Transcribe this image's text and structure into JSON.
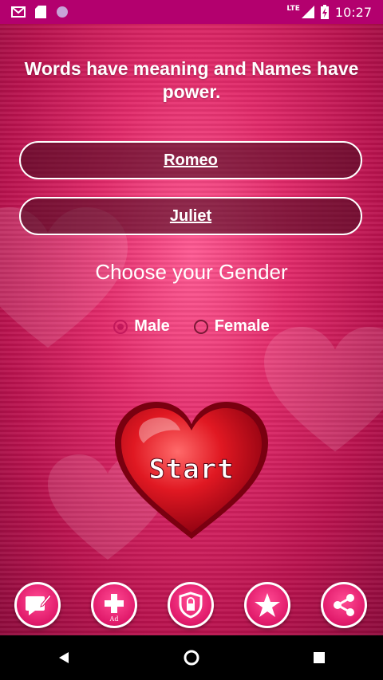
{
  "status_bar": {
    "time": "10:27",
    "network": "LTE",
    "icons": [
      "gmail-icon",
      "sd-card-icon",
      "circle-app-icon",
      "signal-icon",
      "battery-icon"
    ]
  },
  "main": {
    "headline": "Words have meaning and Names have power.",
    "name1": "Romeo",
    "name2": "Juliet",
    "gender_title": "Choose your Gender",
    "gender_options": [
      {
        "label": "Male",
        "selected": true
      },
      {
        "label": "Female",
        "selected": false
      }
    ],
    "start_label": "Start"
  },
  "bottom_actions": [
    {
      "icon": "edit-note-icon"
    },
    {
      "icon": "plus-icon",
      "sub_label": "Ad"
    },
    {
      "icon": "shield-lock-icon"
    },
    {
      "icon": "star-icon"
    },
    {
      "icon": "share-icon"
    }
  ],
  "nav": [
    "back-icon",
    "home-icon",
    "recents-icon"
  ],
  "colors": {
    "status_bar": "#b3006e",
    "accent": "#e0196a",
    "heart": "#d0102c"
  }
}
